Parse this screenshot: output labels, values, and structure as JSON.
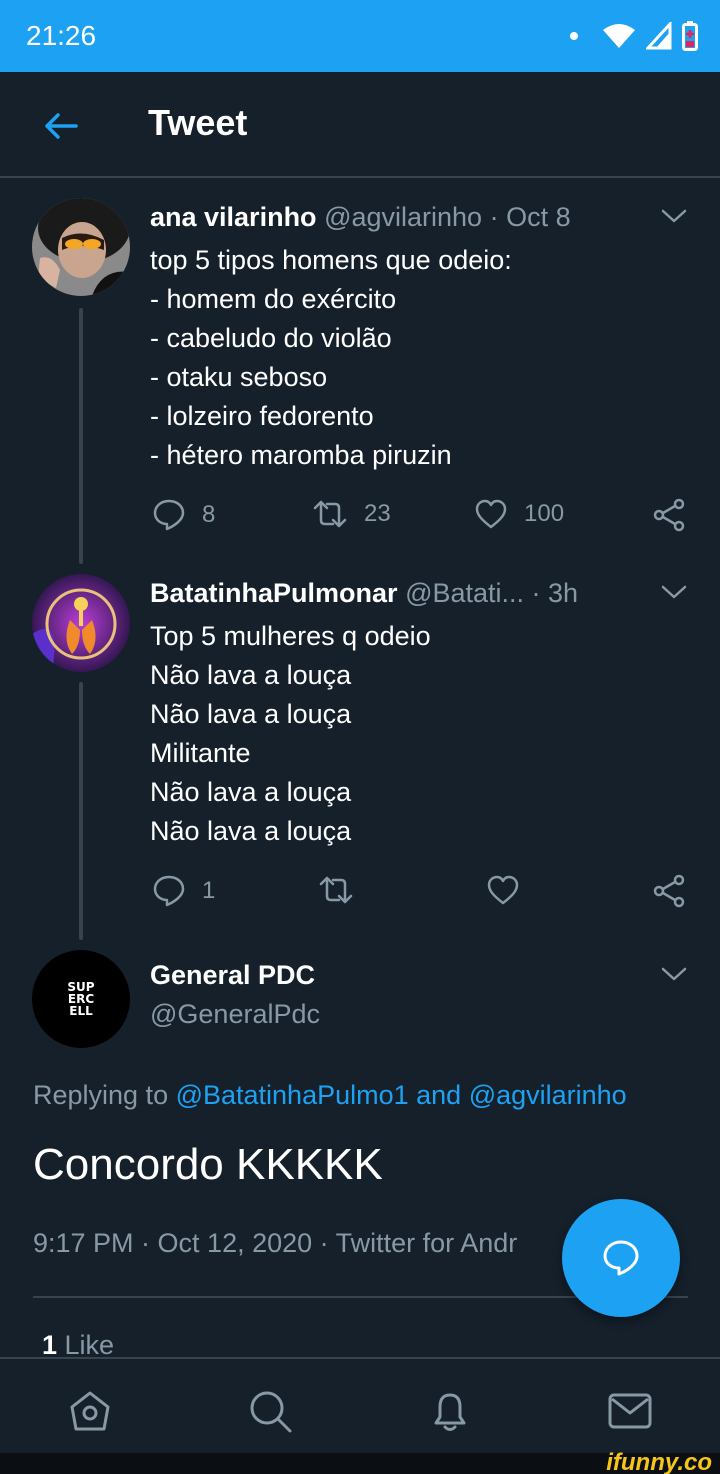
{
  "status_bar": {
    "time": "21:26"
  },
  "header": {
    "title": "Tweet"
  },
  "tweets": [
    {
      "name": "ana vilarinho",
      "meta": "@agvilarinho · Oct 8",
      "lines": [
        "top 5 tipos homens que odeio:",
        "- homem do exército",
        "- cabeludo do violão",
        "- otaku seboso",
        "- lolzeiro fedorento",
        "- hétero maromba piruzin"
      ],
      "replies": "8",
      "retweets": "23",
      "likes": "100"
    },
    {
      "name": "BatatinhaPulmonar",
      "meta": "@Batati...  · 3h",
      "lines": [
        "Top 5 mulheres q odeio",
        "Não lava a louça",
        "Não lava a louça",
        "Militante",
        "Não lava a louça",
        "Não lava a louça"
      ],
      "replies": "1",
      "retweets": "",
      "likes": ""
    }
  ],
  "main_tweet": {
    "name": "General PDC",
    "handle": "@GeneralPdc",
    "avatar_text": "SUP ERC ELL",
    "replying_prefix": "Replying to ",
    "replying_user1": "@BatatinhaPulmo1",
    "replying_and": " and ",
    "replying_user2": "@agvilarinho",
    "text": "Concordo KKKKK",
    "timestamp": "9:17 PM · Oct 12, 2020 · Twitter for Andr",
    "likes_count": "1",
    "likes_label": " Like"
  },
  "watermark": "ifunny.co",
  "colors": {
    "accent": "#1da1f2",
    "background": "#15202b",
    "muted": "#8899a6",
    "border": "#38444d"
  }
}
